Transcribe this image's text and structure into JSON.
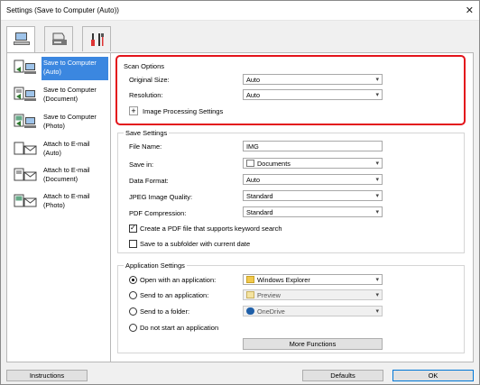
{
  "window": {
    "title": "Settings (Save to Computer (Auto))"
  },
  "top_tabs": [
    "scanner-from-computer-icon",
    "scanner-operation-panel-icon",
    "general-settings-tools-icon"
  ],
  "sidebar": {
    "items": [
      {
        "label1": "Save to Computer",
        "label2": "(Auto)"
      },
      {
        "label1": "Save to Computer",
        "label2": "(Document)"
      },
      {
        "label1": "Save to Computer",
        "label2": "(Photo)"
      },
      {
        "label1": "Attach to E-mail",
        "label2": "(Auto)"
      },
      {
        "label1": "Attach to E-mail",
        "label2": "(Document)"
      },
      {
        "label1": "Attach to E-mail",
        "label2": "(Photo)"
      }
    ]
  },
  "scan_options": {
    "title": "Scan Options",
    "original_size_label": "Original Size:",
    "original_size_value": "Auto",
    "resolution_label": "Resolution:",
    "resolution_value": "Auto",
    "image_processing_label": "Image Processing Settings"
  },
  "save_settings": {
    "title": "Save Settings",
    "file_name_label": "File Name:",
    "file_name_value": "IMG",
    "save_in_label": "Save in:",
    "save_in_value": "Documents",
    "data_format_label": "Data Format:",
    "data_format_value": "Auto",
    "jpeg_quality_label": "JPEG Image Quality:",
    "jpeg_quality_value": "Standard",
    "pdf_compression_label": "PDF Compression:",
    "pdf_compression_value": "Standard",
    "keyword_search_label": "Create a PDF file that supports keyword search",
    "keyword_search_checked": true,
    "subfolder_label": "Save to a subfolder with current date",
    "subfolder_checked": false
  },
  "application_settings": {
    "title": "Application Settings",
    "open_with_label": "Open with an application:",
    "open_with_value": "Windows Explorer",
    "send_to_app_label": "Send to an application:",
    "send_to_app_value": "Preview",
    "send_to_folder_label": "Send to a folder:",
    "send_to_folder_value": "OneDrive",
    "do_not_start_label": "Do not start an application",
    "more_functions_label": "More Functions",
    "selected": "open_with"
  },
  "footer": {
    "instructions_label": "Instructions",
    "defaults_label": "Defaults",
    "ok_label": "OK"
  },
  "colors": {
    "accent": "#3b87e0",
    "highlight_box": "#e3141b"
  }
}
